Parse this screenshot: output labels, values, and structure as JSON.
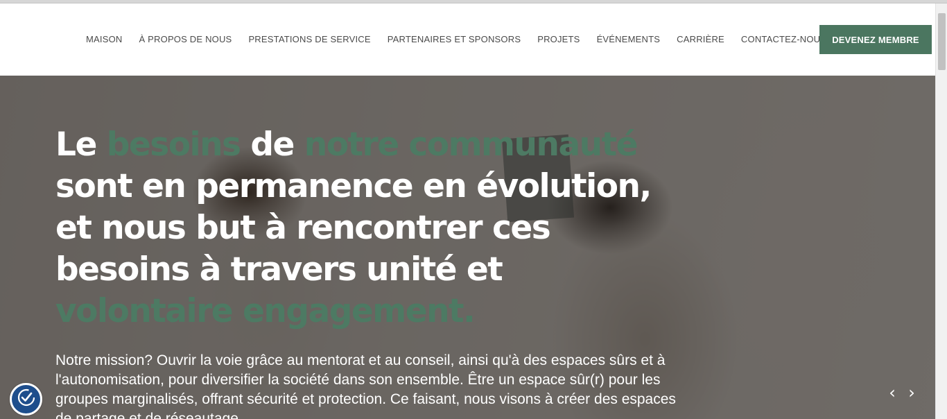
{
  "nav": {
    "items": [
      {
        "label": "MAISON"
      },
      {
        "label": "À PROPOS DE NOUS"
      },
      {
        "label": "PRESTATIONS DE SERVICE"
      },
      {
        "label": "PARTENAIRES ET SPONSORS"
      },
      {
        "label": "PROJETS"
      },
      {
        "label": "ÉVÉNEMENTS"
      },
      {
        "label": "CARRIÈRE"
      },
      {
        "label": "CONTACTEZ-NOUS"
      }
    ],
    "cta_label": "DEVENEZ MEMBRE"
  },
  "hero": {
    "headline": {
      "line1": [
        "Le ",
        "besoins",
        " de ",
        "notre communauté"
      ],
      "line2": "sont en  permanence en  évolution,",
      "line3": "et nous but à rencontrer ces",
      "line4": "besoins à  travers unité et",
      "line5": "volontaire engagement."
    },
    "mission": "Notre mission? Ouvrir la voie grâce au mentorat et au conseil, ainsi qu'à des espaces sûrs et à l'autonomisation, pour diversifier la société dans son ensemble. Être un espace sûr(r) pour les groupes marginalisés, offrant sécurité et protection. Ce faisant, nous visons à créer des espaces de partage et de réseautage.",
    "prev_icon": "‹",
    "next_icon": "›"
  },
  "colors": {
    "accent": "#4b7660",
    "overlay": "#231f1c",
    "a11y_badge": "#1e4e8c"
  },
  "icons": {
    "accessibility": "accessibility-icon",
    "prev": "chevron-left-icon",
    "next": "chevron-right-icon"
  }
}
